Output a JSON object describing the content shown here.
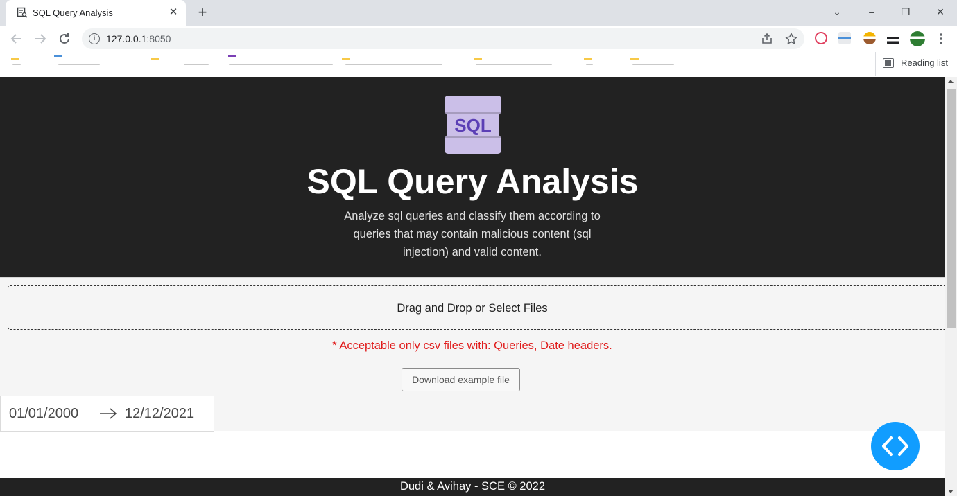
{
  "browser": {
    "tab_title": "SQL Query Analysis",
    "tab_close": "✕",
    "new_tab": "+",
    "window_controls": {
      "minimize": "–",
      "restore": "❐",
      "close": "✕",
      "tab_search": "⌄"
    },
    "url_host": "127.0.0.1",
    "url_port": ":8050",
    "reading_list_label": "Reading list",
    "icons": [
      "back-icon",
      "forward-icon",
      "reload-icon",
      "info-icon",
      "share-icon",
      "star-icon",
      "menu-icon",
      "reading-list-icon"
    ]
  },
  "header": {
    "logo_text": "SQL",
    "title": "SQL Query Analysis",
    "subtitle": "Analyze sql queries and classify them according to queries that may contain malicious content (sql injection) and valid content."
  },
  "upload": {
    "label": "Drag and Drop or Select Files",
    "note": "* Acceptable only csv files with: Queries, Date headers.",
    "download_button": "Download example file"
  },
  "date_range": {
    "start": "01/01/2000",
    "end": "12/12/2021"
  },
  "footer": {
    "text": "Dudi & Avihay - SCE © 2022"
  },
  "colors": {
    "header_bg": "#222222",
    "logo_bg": "#cbbfe8",
    "logo_text": "#5b3fb5",
    "note": "#e01b1b",
    "fab": "#119dff"
  }
}
